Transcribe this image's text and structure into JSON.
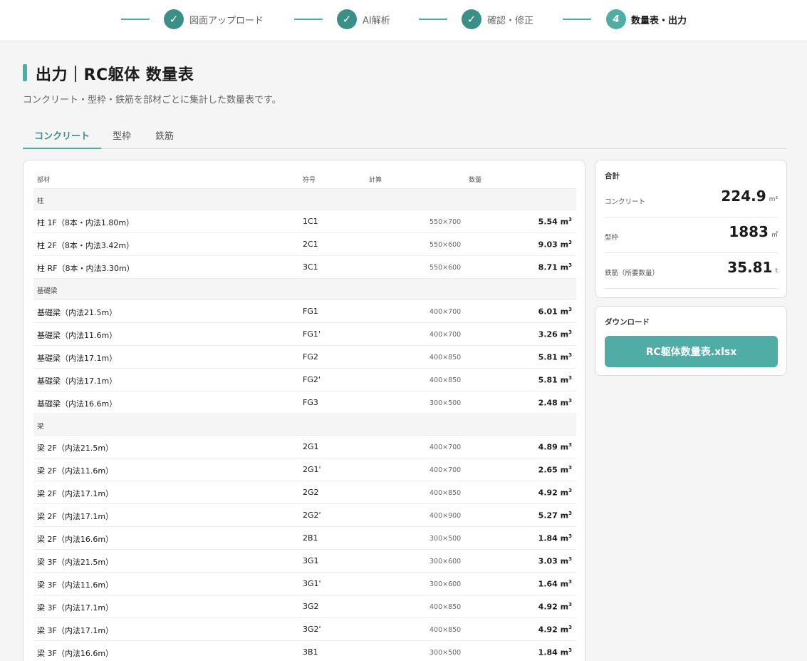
{
  "stepper": {
    "steps": [
      {
        "label": "図面アップロード",
        "icon": "check-icon",
        "mark": "✓"
      },
      {
        "label": "AI解析",
        "icon": "check-icon",
        "mark": "✓"
      },
      {
        "label": "確認・修正",
        "icon": "check-icon",
        "mark": "✓"
      },
      {
        "label": "数量表・出力",
        "number": "4"
      }
    ],
    "accent_color": "#4fada6"
  },
  "header": {
    "title": "出力｜RC躯体 数量表",
    "subtitle": "コンクリート・型枠・鉄筋を部材ごとに集計した数量表です。"
  },
  "tabs": [
    {
      "label": "コンクリート",
      "active": true
    },
    {
      "label": "型枠",
      "active": false
    },
    {
      "label": "鉄筋",
      "active": false
    }
  ],
  "table": {
    "columns": [
      "部材",
      "符号",
      "計算",
      "数量"
    ],
    "unit": "m",
    "unit_sup": "3",
    "groups": [
      {
        "name": "柱",
        "rows": [
          {
            "name": "柱 1F（8本・内法1.80m）",
            "symbol": "1C1",
            "calc": "550×700",
            "qty": "5.54"
          },
          {
            "name": "柱 2F（8本・内法3.42m）",
            "symbol": "2C1",
            "calc": "550×600",
            "qty": "9.03"
          },
          {
            "name": "柱 RF（8本・内法3.30m）",
            "symbol": "3C1",
            "calc": "550×600",
            "qty": "8.71"
          }
        ]
      },
      {
        "name": "基礎梁",
        "rows": [
          {
            "name": "基礎梁（内法21.5m）",
            "symbol": "FG1",
            "calc": "400×700",
            "qty": "6.01"
          },
          {
            "name": "基礎梁（内法11.6m）",
            "symbol": "FG1'",
            "calc": "400×700",
            "qty": "3.26"
          },
          {
            "name": "基礎梁（内法17.1m）",
            "symbol": "FG2",
            "calc": "400×850",
            "qty": "5.81"
          },
          {
            "name": "基礎梁（内法17.1m）",
            "symbol": "FG2'",
            "calc": "400×850",
            "qty": "5.81"
          },
          {
            "name": "基礎梁（内法16.6m）",
            "symbol": "FG3",
            "calc": "300×500",
            "qty": "2.48"
          }
        ]
      },
      {
        "name": "梁",
        "rows": [
          {
            "name": "梁 2F（内法21.5m）",
            "symbol": "2G1",
            "calc": "400×700",
            "qty": "4.89"
          },
          {
            "name": "梁 2F（内法11.6m）",
            "symbol": "2G1'",
            "calc": "400×700",
            "qty": "2.65"
          },
          {
            "name": "梁 2F（内法17.1m）",
            "symbol": "2G2",
            "calc": "400×850",
            "qty": "4.92"
          },
          {
            "name": "梁 2F（内法17.1m）",
            "symbol": "2G2'",
            "calc": "400×900",
            "qty": "5.27"
          },
          {
            "name": "梁 2F（内法16.6m）",
            "symbol": "2B1",
            "calc": "300×500",
            "qty": "1.84"
          },
          {
            "name": "梁 3F（内法21.5m）",
            "symbol": "3G1",
            "calc": "300×600",
            "qty": "3.03"
          },
          {
            "name": "梁 3F（内法11.6m）",
            "symbol": "3G1'",
            "calc": "300×600",
            "qty": "1.64"
          },
          {
            "name": "梁 3F（内法17.1m）",
            "symbol": "3G2",
            "calc": "400×850",
            "qty": "4.92"
          },
          {
            "name": "梁 3F（内法17.1m）",
            "symbol": "3G2'",
            "calc": "400×850",
            "qty": "4.92"
          },
          {
            "name": "梁 3F（内法16.6m）",
            "symbol": "3B1",
            "calc": "300×500",
            "qty": "1.84"
          }
        ]
      }
    ]
  },
  "summary": {
    "title": "合計",
    "items": [
      {
        "label": "コンクリート",
        "value": "224.9",
        "unit": "m³"
      },
      {
        "label": "型枠",
        "value": "1883",
        "unit": "㎡"
      },
      {
        "label": "鉄筋（所要数量）",
        "value": "35.81",
        "unit": "t"
      }
    ]
  },
  "download": {
    "title": "ダウンロード",
    "button_label": "RC躯体数量表.xlsx"
  }
}
